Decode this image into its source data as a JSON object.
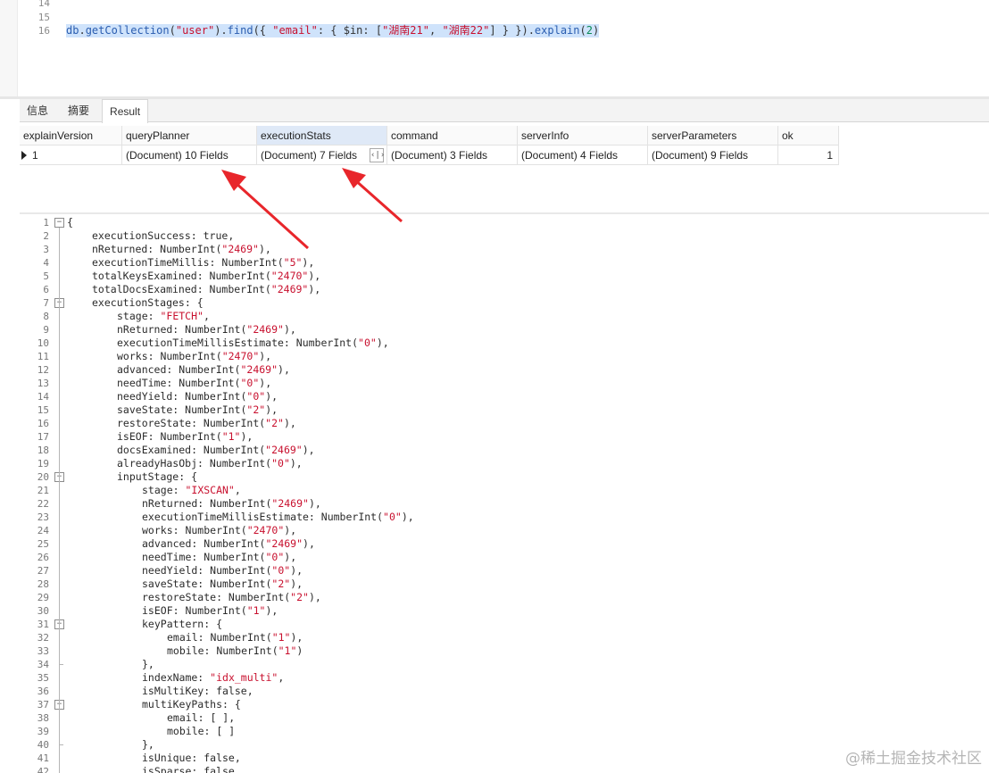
{
  "editor": {
    "lines": [
      {
        "num": "14",
        "segments": []
      },
      {
        "num": "15",
        "segments": []
      },
      {
        "num": "16",
        "segments": [
          {
            "t": "db",
            "c": "t-id"
          },
          {
            "t": ".",
            "c": "t-plain"
          },
          {
            "t": "getCollection",
            "c": "t-id"
          },
          {
            "t": "(",
            "c": "t-plain"
          },
          {
            "t": "\"user\"",
            "c": "t-str"
          },
          {
            "t": ").",
            "c": "t-plain"
          },
          {
            "t": "find",
            "c": "t-id"
          },
          {
            "t": "({ ",
            "c": "t-plain"
          },
          {
            "t": "\"email\"",
            "c": "t-str"
          },
          {
            "t": ": { $in: [",
            "c": "t-plain"
          },
          {
            "t": "\"湖南21\"",
            "c": "t-str"
          },
          {
            "t": ", ",
            "c": "t-plain"
          },
          {
            "t": "\"湖南22\"",
            "c": "t-str"
          },
          {
            "t": "] } }).",
            "c": "t-plain"
          },
          {
            "t": "explain",
            "c": "t-id"
          },
          {
            "t": "(",
            "c": "t-plain"
          },
          {
            "t": "2",
            "c": "t-num"
          },
          {
            "t": ")",
            "c": "t-plain"
          }
        ]
      }
    ]
  },
  "tabs": [
    {
      "label": "信息",
      "active": false
    },
    {
      "label": "摘要",
      "active": false
    },
    {
      "label": "Result",
      "active": true
    }
  ],
  "grid": {
    "columns": [
      "explainVersion",
      "queryPlanner",
      "executionStats",
      "command",
      "serverInfo",
      "serverParameters",
      "ok"
    ],
    "highlighted_column": "executionStats",
    "rows": [
      [
        "1",
        "(Document) 10 Fields",
        "(Document) 7 Fields",
        "(Document) 3 Fields",
        "(Document) 4 Fields",
        "(Document) 9 Fields",
        "1"
      ]
    ],
    "expand_button_label": "‹|›"
  },
  "viewer": {
    "lines": [
      {
        "n": "1",
        "indent": 0,
        "fold": "open",
        "segs": [
          {
            "t": "{"
          }
        ]
      },
      {
        "n": "2",
        "indent": 1,
        "segs": [
          {
            "t": "executionSuccess: true,"
          }
        ]
      },
      {
        "n": "3",
        "indent": 1,
        "segs": [
          {
            "t": "nReturned: NumberInt("
          },
          {
            "t": "\"2469\"",
            "s": 1
          },
          {
            "t": "),"
          }
        ]
      },
      {
        "n": "4",
        "indent": 1,
        "segs": [
          {
            "t": "executionTimeMillis: NumberInt("
          },
          {
            "t": "\"5\"",
            "s": 1
          },
          {
            "t": "),"
          }
        ]
      },
      {
        "n": "5",
        "indent": 1,
        "segs": [
          {
            "t": "totalKeysExamined: NumberInt("
          },
          {
            "t": "\"2470\"",
            "s": 1
          },
          {
            "t": "),"
          }
        ]
      },
      {
        "n": "6",
        "indent": 1,
        "segs": [
          {
            "t": "totalDocsExamined: NumberInt("
          },
          {
            "t": "\"2469\"",
            "s": 1
          },
          {
            "t": "),"
          }
        ]
      },
      {
        "n": "7",
        "indent": 1,
        "fold": "open",
        "segs": [
          {
            "t": "executionStages: {"
          }
        ]
      },
      {
        "n": "8",
        "indent": 2,
        "segs": [
          {
            "t": "stage: "
          },
          {
            "t": "\"FETCH\"",
            "s": 1
          },
          {
            "t": ","
          }
        ]
      },
      {
        "n": "9",
        "indent": 2,
        "segs": [
          {
            "t": "nReturned: NumberInt("
          },
          {
            "t": "\"2469\"",
            "s": 1
          },
          {
            "t": "),"
          }
        ]
      },
      {
        "n": "10",
        "indent": 2,
        "segs": [
          {
            "t": "executionTimeMillisEstimate: NumberInt("
          },
          {
            "t": "\"0\"",
            "s": 1
          },
          {
            "t": "),"
          }
        ]
      },
      {
        "n": "11",
        "indent": 2,
        "segs": [
          {
            "t": "works: NumberInt("
          },
          {
            "t": "\"2470\"",
            "s": 1
          },
          {
            "t": "),"
          }
        ]
      },
      {
        "n": "12",
        "indent": 2,
        "segs": [
          {
            "t": "advanced: NumberInt("
          },
          {
            "t": "\"2469\"",
            "s": 1
          },
          {
            "t": "),"
          }
        ]
      },
      {
        "n": "13",
        "indent": 2,
        "segs": [
          {
            "t": "needTime: NumberInt("
          },
          {
            "t": "\"0\"",
            "s": 1
          },
          {
            "t": "),"
          }
        ]
      },
      {
        "n": "14",
        "indent": 2,
        "segs": [
          {
            "t": "needYield: NumberInt("
          },
          {
            "t": "\"0\"",
            "s": 1
          },
          {
            "t": "),"
          }
        ]
      },
      {
        "n": "15",
        "indent": 2,
        "segs": [
          {
            "t": "saveState: NumberInt("
          },
          {
            "t": "\"2\"",
            "s": 1
          },
          {
            "t": "),"
          }
        ]
      },
      {
        "n": "16",
        "indent": 2,
        "segs": [
          {
            "t": "restoreState: NumberInt("
          },
          {
            "t": "\"2\"",
            "s": 1
          },
          {
            "t": "),"
          }
        ]
      },
      {
        "n": "17",
        "indent": 2,
        "segs": [
          {
            "t": "isEOF: NumberInt("
          },
          {
            "t": "\"1\"",
            "s": 1
          },
          {
            "t": "),"
          }
        ]
      },
      {
        "n": "18",
        "indent": 2,
        "segs": [
          {
            "t": "docsExamined: NumberInt("
          },
          {
            "t": "\"2469\"",
            "s": 1
          },
          {
            "t": "),"
          }
        ]
      },
      {
        "n": "19",
        "indent": 2,
        "segs": [
          {
            "t": "alreadyHasObj: NumberInt("
          },
          {
            "t": "\"0\"",
            "s": 1
          },
          {
            "t": "),"
          }
        ]
      },
      {
        "n": "20",
        "indent": 2,
        "fold": "open",
        "segs": [
          {
            "t": "inputStage: {"
          }
        ]
      },
      {
        "n": "21",
        "indent": 3,
        "segs": [
          {
            "t": "stage: "
          },
          {
            "t": "\"IXSCAN\"",
            "s": 1
          },
          {
            "t": ","
          }
        ]
      },
      {
        "n": "22",
        "indent": 3,
        "segs": [
          {
            "t": "nReturned: NumberInt("
          },
          {
            "t": "\"2469\"",
            "s": 1
          },
          {
            "t": "),"
          }
        ]
      },
      {
        "n": "23",
        "indent": 3,
        "segs": [
          {
            "t": "executionTimeMillisEstimate: NumberInt("
          },
          {
            "t": "\"0\"",
            "s": 1
          },
          {
            "t": "),"
          }
        ]
      },
      {
        "n": "24",
        "indent": 3,
        "segs": [
          {
            "t": "works: NumberInt("
          },
          {
            "t": "\"2470\"",
            "s": 1
          },
          {
            "t": "),"
          }
        ]
      },
      {
        "n": "25",
        "indent": 3,
        "segs": [
          {
            "t": "advanced: NumberInt("
          },
          {
            "t": "\"2469\"",
            "s": 1
          },
          {
            "t": "),"
          }
        ]
      },
      {
        "n": "26",
        "indent": 3,
        "segs": [
          {
            "t": "needTime: NumberInt("
          },
          {
            "t": "\"0\"",
            "s": 1
          },
          {
            "t": "),"
          }
        ]
      },
      {
        "n": "27",
        "indent": 3,
        "segs": [
          {
            "t": "needYield: NumberInt("
          },
          {
            "t": "\"0\"",
            "s": 1
          },
          {
            "t": "),"
          }
        ]
      },
      {
        "n": "28",
        "indent": 3,
        "segs": [
          {
            "t": "saveState: NumberInt("
          },
          {
            "t": "\"2\"",
            "s": 1
          },
          {
            "t": "),"
          }
        ]
      },
      {
        "n": "29",
        "indent": 3,
        "segs": [
          {
            "t": "restoreState: NumberInt("
          },
          {
            "t": "\"2\"",
            "s": 1
          },
          {
            "t": "),"
          }
        ]
      },
      {
        "n": "30",
        "indent": 3,
        "segs": [
          {
            "t": "isEOF: NumberInt("
          },
          {
            "t": "\"1\"",
            "s": 1
          },
          {
            "t": "),"
          }
        ]
      },
      {
        "n": "31",
        "indent": 3,
        "fold": "open",
        "segs": [
          {
            "t": "keyPattern: {"
          }
        ]
      },
      {
        "n": "32",
        "indent": 4,
        "segs": [
          {
            "t": "email: NumberInt("
          },
          {
            "t": "\"1\"",
            "s": 1
          },
          {
            "t": "),"
          }
        ]
      },
      {
        "n": "33",
        "indent": 4,
        "segs": [
          {
            "t": "mobile: NumberInt("
          },
          {
            "t": "\"1\"",
            "s": 1
          },
          {
            "t": ")"
          }
        ]
      },
      {
        "n": "34",
        "indent": 3,
        "fold": "end",
        "segs": [
          {
            "t": "},"
          }
        ]
      },
      {
        "n": "35",
        "indent": 3,
        "segs": [
          {
            "t": "indexName: "
          },
          {
            "t": "\"idx_multi\"",
            "s": 1
          },
          {
            "t": ","
          }
        ]
      },
      {
        "n": "36",
        "indent": 3,
        "segs": [
          {
            "t": "isMultiKey: false,"
          }
        ]
      },
      {
        "n": "37",
        "indent": 3,
        "fold": "open",
        "segs": [
          {
            "t": "multiKeyPaths: {"
          }
        ]
      },
      {
        "n": "38",
        "indent": 4,
        "segs": [
          {
            "t": "email: [ ],"
          }
        ]
      },
      {
        "n": "39",
        "indent": 4,
        "segs": [
          {
            "t": "mobile: [ ]"
          }
        ]
      },
      {
        "n": "40",
        "indent": 3,
        "fold": "end",
        "segs": [
          {
            "t": "},"
          }
        ]
      },
      {
        "n": "41",
        "indent": 3,
        "segs": [
          {
            "t": "isUnique: false,"
          }
        ]
      },
      {
        "n": "42",
        "indent": 3,
        "segs": [
          {
            "t": "isSparse: false,"
          }
        ]
      }
    ]
  },
  "watermark": "@稀土掘金技术社区",
  "colors": {
    "arrow": "#e8262b",
    "selection": "#cfe3fb",
    "string": "#c8102e",
    "identifier": "#2a5db0"
  }
}
